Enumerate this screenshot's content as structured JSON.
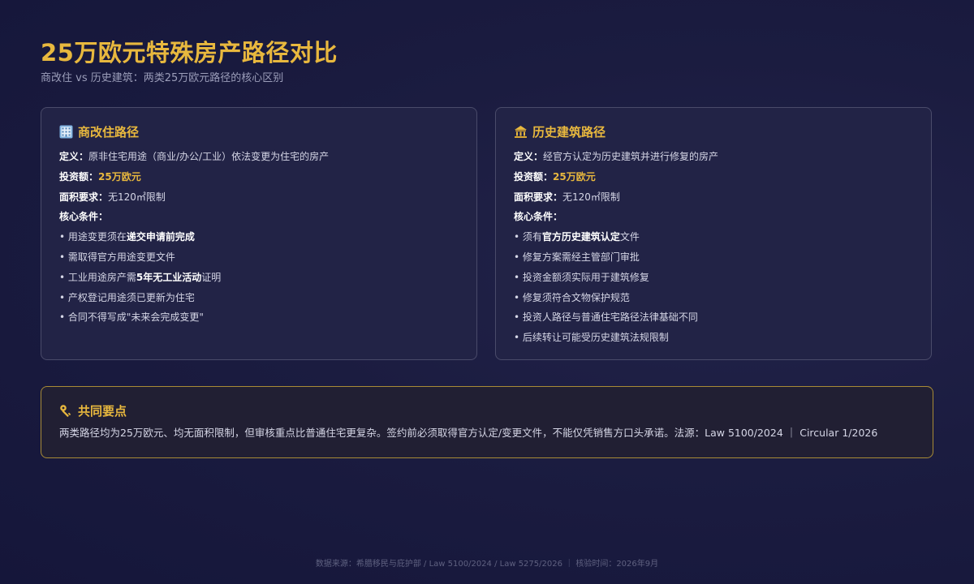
{
  "header": {
    "title": "25万欧元特殊房产路径对比",
    "subtitle": "商改住 vs 历史建筑：两类25万欧元路径的核心区别"
  },
  "cards": {
    "conversion": {
      "icon": "office-building-icon",
      "title": "商改住路径",
      "definition_label": "定义：",
      "definition": "原非住宅用途（商业/办公/工业）依法变更为住宅的房产",
      "investment_label": "投资额：",
      "investment": "25万欧元",
      "area_label": "面积要求：",
      "area": "无120㎡限制",
      "conditions_label": "核心条件：",
      "conditions": [
        {
          "pre": "• 用途变更须在",
          "bold": "递交申请前完成",
          "post": ""
        },
        {
          "pre": "• 需取得官方用途变更文件",
          "bold": "",
          "post": ""
        },
        {
          "pre": "• 工业用途房产需",
          "bold": "5年无工业活动",
          "post": "证明"
        },
        {
          "pre": "• 产权登记用途须已更新为住宅",
          "bold": "",
          "post": ""
        },
        {
          "pre": "• 合同不得写成\"未来会完成变更\"",
          "bold": "",
          "post": ""
        }
      ]
    },
    "heritage": {
      "icon": "historic-building-icon",
      "title": "历史建筑路径",
      "definition_label": "定义：",
      "definition": "经官方认定为历史建筑并进行修复的房产",
      "investment_label": "投资额：",
      "investment": "25万欧元",
      "area_label": "面积要求：",
      "area": "无120㎡限制",
      "conditions_label": "核心条件：",
      "conditions": [
        {
          "pre": "• 须有",
          "bold": "官方历史建筑认定",
          "post": "文件"
        },
        {
          "pre": "• 修复方案需经主管部门审批",
          "bold": "",
          "post": ""
        },
        {
          "pre": "• 投资金额须实际用于建筑修复",
          "bold": "",
          "post": ""
        },
        {
          "pre": "• 修复须符合文物保护规范",
          "bold": "",
          "post": ""
        },
        {
          "pre": "• 投资人路径与普通住宅路径法律基础不同",
          "bold": "",
          "post": ""
        },
        {
          "pre": "• 后续转让可能受历史建筑法规限制",
          "bold": "",
          "post": ""
        }
      ]
    }
  },
  "common": {
    "icon": "key-icon",
    "title": "共同要点",
    "text": "两类路径均为25万欧元、均无面积限制，但审核重点比普通住宅更复杂。签约前必须取得官方认定/变更文件，不能仅凭销售方口头承诺。法源：Law 5100/2024 ｜ Circular 1/2026"
  },
  "footer": {
    "text": "数据来源：希腊移民与庇护部 / Law 5100/2024 / Law 5275/2026 ｜ 核验时间：2026年9月"
  },
  "colors": {
    "accent": "#e8b83e",
    "background": "#1b1c40",
    "card_border": "#4a4b6a",
    "common_border": "#a88b36"
  }
}
